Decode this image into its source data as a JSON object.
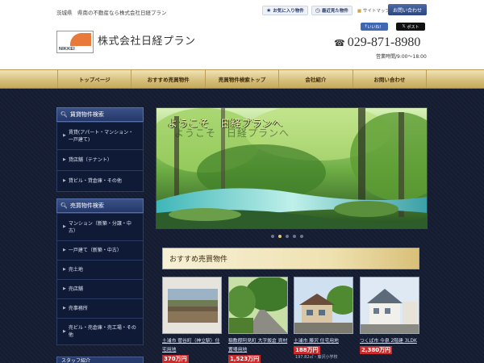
{
  "header": {
    "tagline": "茨城県　県南の不動産なら株式会社日経プラン",
    "tools": {
      "favorites": "お気に入り物件",
      "recent": "最近見た物件",
      "sitemap": "サイトマップ"
    },
    "contact_button": "お問い合わせ",
    "logo_text": "NIKKEI",
    "company_name": "株式会社日経プラン",
    "social": {
      "facebook": "いいね！",
      "x": "ポスト"
    },
    "phone": "029-871-8980",
    "hours": "営業時間/9:00～18:00"
  },
  "nav": [
    "トップページ",
    "おすすめ売買物件",
    "売買物件検索トップ",
    "会社紹介",
    "お問い合わせ"
  ],
  "sidebar": {
    "rental": {
      "title": "賃貸物件検索",
      "items": [
        "賃貸(アパート・マンション・一戸建て)",
        "貸店舗（テナント）",
        "貸ビル・貸倉庫・その他"
      ]
    },
    "sale": {
      "title": "売買物件検索",
      "items": [
        "マンション（新築・分譲・中古）",
        "一戸建て（新築・中古）",
        "売土地",
        "売店舗",
        "売事務所",
        "売ビル・売倉庫・売工場・その他"
      ]
    },
    "bottom_title": "スタッフ紹介"
  },
  "hero": {
    "caption": "ようこそ　日経プランへ",
    "dots": 5,
    "active_dot": 2
  },
  "section": {
    "title": "おすすめ売買物件"
  },
  "cards": [
    {
      "name": "土浦市 菅谷町（神立駅）住宅用地",
      "price": "370万円",
      "sub": ""
    },
    {
      "name": "稲敷郡阿見町 大字飯倉 資材置場用地",
      "price": "1,523万円",
      "sub": ""
    },
    {
      "name": "土浦市 藤沢 住宅用地",
      "price": "188万円",
      "sub": "197.82㎡・藤沢小学校"
    },
    {
      "name": "つくば市 今泉 2階建 3LDK",
      "price": "2,380万円",
      "sub": ""
    }
  ],
  "colors": {
    "nav_gold": "#d7c07c",
    "dark_bg": "#151d33",
    "sidebar_head": "#2b3f73",
    "price_red": "#cc2b2b",
    "contact_blue": "#3a5590"
  }
}
